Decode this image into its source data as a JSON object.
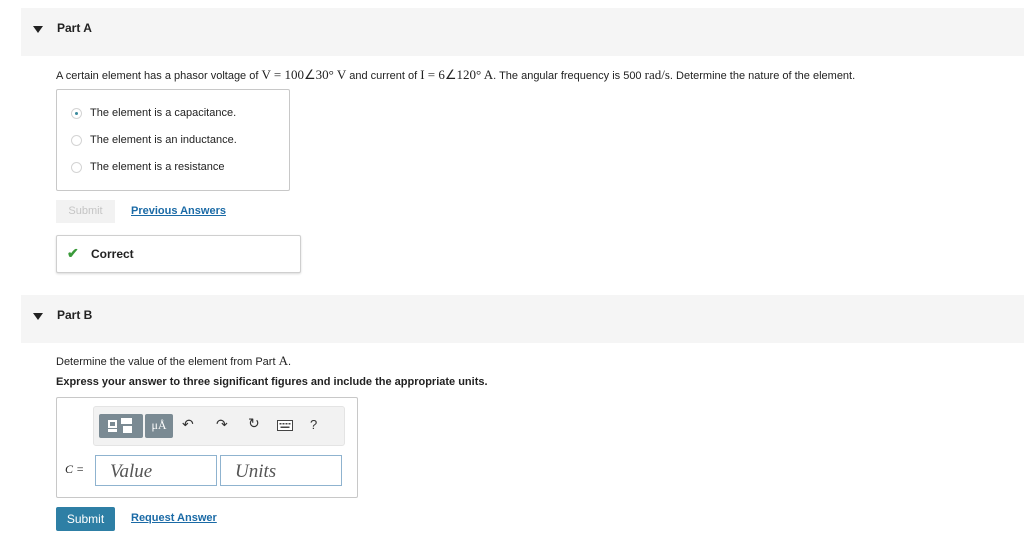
{
  "part_a": {
    "title": "Part A",
    "question_prefix": "A certain element has a phasor voltage of ",
    "voltage": "V = 100∠30° V",
    "question_mid": " and current of ",
    "current": "I = 6∠120° A",
    "question_mid2": ". The angular frequency is 500 ",
    "unit": "rad/s",
    "question_suffix": ". Determine the nature of the element.",
    "choices": [
      {
        "label": "The element is a capacitance.",
        "selected": true
      },
      {
        "label": "The element is an inductance.",
        "selected": false
      },
      {
        "label": "The element is a resistance",
        "selected": false
      }
    ],
    "submit_label": "Submit",
    "previous_answers_label": "Previous Answers",
    "feedback_label": "Correct"
  },
  "part_b": {
    "title": "Part B",
    "question_prefix": "Determine the value of the element from Part ",
    "question_ref": "A",
    "question_suffix": ".",
    "instruction": "Express your answer to three significant figures and include the appropriate units.",
    "variable_label": "C =",
    "value_placeholder": "Value",
    "units_placeholder": "Units",
    "toolbar": {
      "units_button": "μÅ",
      "help": "?"
    },
    "submit_label": "Submit",
    "request_answer_label": "Request Answer"
  },
  "colors": {
    "header_bg": "#f5f5f5",
    "submit_bg": "#2e7fa5",
    "link": "#1a6aa6",
    "correct_check": "#3a9a3a"
  }
}
